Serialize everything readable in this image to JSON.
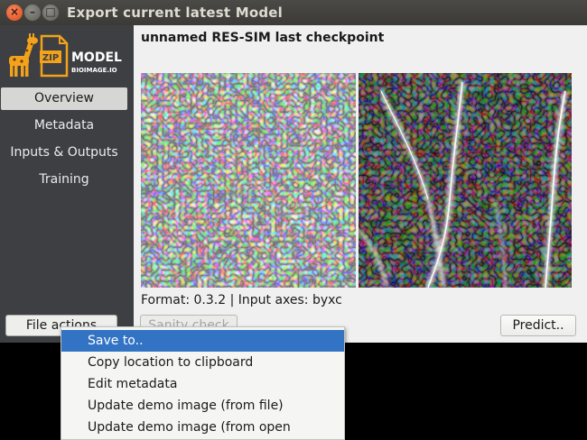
{
  "window": {
    "title": "Export current latest Model",
    "close_glyph": "×",
    "minimize_glyph": "–",
    "maximize_glyph": "□"
  },
  "logo": {
    "zip_label": "ZIP",
    "model_label": "MODEL",
    "site_label": "BIOIMAGE.IO",
    "accent_color": "#f3a21b"
  },
  "sidebar": {
    "items": [
      {
        "label": "Overview",
        "active": true
      },
      {
        "label": "Metadata",
        "active": false
      },
      {
        "label": "Inputs & Outputs",
        "active": false
      },
      {
        "label": "Training",
        "active": false
      }
    ],
    "file_actions_label": "File actions"
  },
  "main": {
    "title": "unnamed RES-SIM last checkpoint",
    "format_text": "Format: 0.3.2 | Input axes: byxc",
    "sanity_check_label": "Sanity check",
    "predict_label": "Predict.."
  },
  "context_menu": {
    "items": [
      {
        "label": "Save to..",
        "highlighted": true
      },
      {
        "label": "Copy location to clipboard",
        "highlighted": false
      },
      {
        "label": "Edit metadata",
        "highlighted": false
      },
      {
        "label": "Update demo image (from file)",
        "highlighted": false
      },
      {
        "label": "Update demo image (from open images)",
        "highlighted": false
      }
    ],
    "highlight_color": "#3373c4"
  }
}
